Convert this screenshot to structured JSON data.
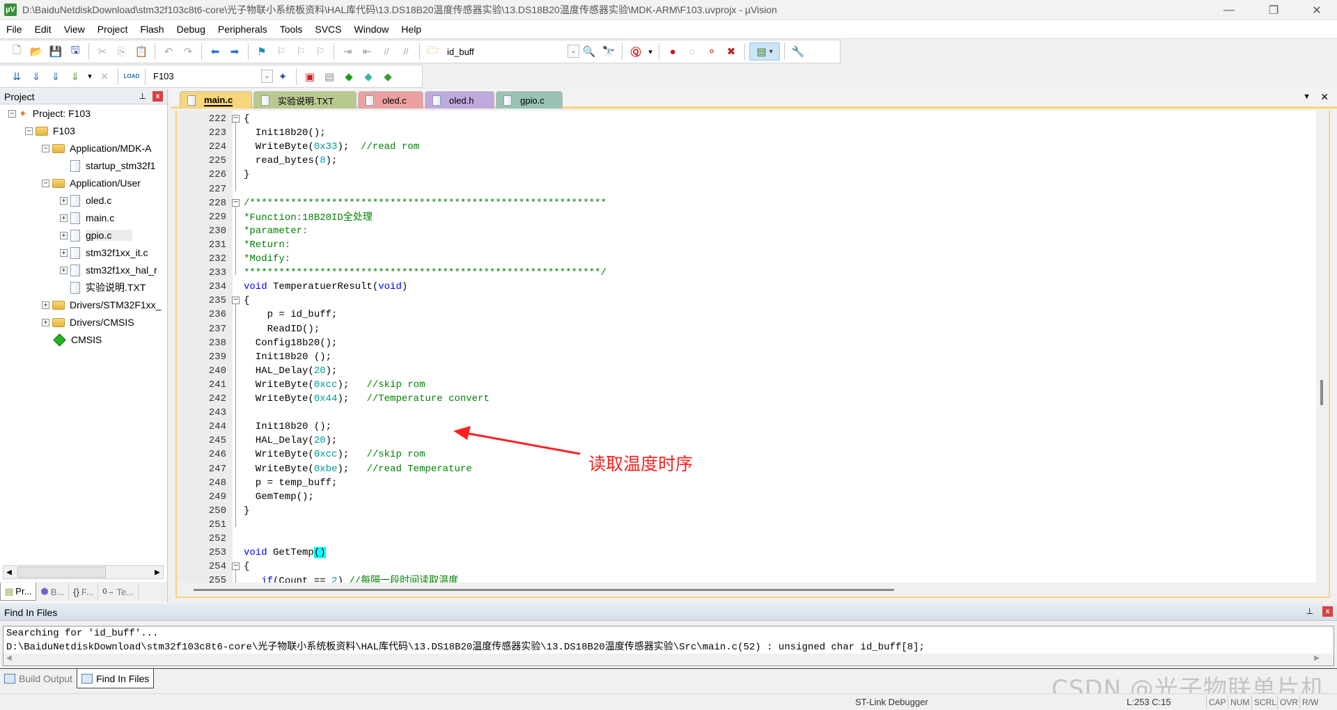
{
  "window": {
    "title": "D:\\BaiduNetdiskDownload\\stm32f103c8t6-core\\光子物联小系统板资料\\HAL库代码\\13.DS18B20温度传感器实验\\13.DS18B20温度传感器实验\\MDK-ARM\\F103.uvprojx - µVision",
    "app_icon": "µV",
    "minimize": "—",
    "maximize": "❐",
    "close": "✕"
  },
  "menu": [
    "File",
    "Edit",
    "View",
    "Project",
    "Flash",
    "Debug",
    "Peripherals",
    "Tools",
    "SVCS",
    "Window",
    "Help"
  ],
  "toolbar1": {
    "icons": {
      "new": "🗋",
      "open": "📂",
      "save": "💾",
      "save_all": "🖫",
      "cut": "✂",
      "copy": "⎘",
      "paste": "📋",
      "undo": "↶",
      "redo": "↷",
      "nav_back": "⬅",
      "nav_forward": "➡",
      "bookmark": "⚑",
      "prev_bookmark": "⚐",
      "next_bookmark": "⚐",
      "clear_bookmarks": "⚐",
      "indent": "⇥",
      "unindent": "⇤",
      "comment": "//",
      "uncomment": "//",
      "find_in_files": "🗁",
      "find": "🔍",
      "incremental_find": "🔭",
      "debug": "Ⓠ",
      "dropdown": "▾",
      "breakpoint": "●",
      "disable_breakpoint": "○",
      "disable_all_bp": "⚬",
      "kill_all_bp": "✖",
      "window_layout": "▤",
      "configure": "🔧"
    },
    "search_value": "id_buff"
  },
  "toolbar2": {
    "icons": {
      "translate": "⇊",
      "build": "⇓",
      "rebuild": "⇓",
      "batch_build": "⇓",
      "stop_build": "✕",
      "download": "LOAD",
      "options": "✦",
      "manage_components": "▣",
      "file_extensions": "▤",
      "run_time_env": "◆",
      "select_packs": "◆",
      "pack_installer": "◆"
    },
    "target_value": "F103"
  },
  "project_panel": {
    "title": "Project",
    "pin": "⊥",
    "close": "x",
    "tree": [
      {
        "label": "Project: F103",
        "level": 0,
        "expander": "−",
        "icon": "project"
      },
      {
        "label": "F103",
        "level": 1,
        "expander": "−",
        "icon": "target"
      },
      {
        "label": "Application/MDK-A",
        "level": 2,
        "expander": "−",
        "icon": "folder"
      },
      {
        "label": "startup_stm32f1",
        "level": 3,
        "expander": "",
        "icon": "file"
      },
      {
        "label": "Application/User",
        "level": 2,
        "expander": "−",
        "icon": "folder"
      },
      {
        "label": "oled.c",
        "level": 3,
        "expander": "+",
        "icon": "file"
      },
      {
        "label": "main.c",
        "level": 3,
        "expander": "+",
        "icon": "file"
      },
      {
        "label": "gpio.c",
        "level": 3,
        "expander": "+",
        "icon": "file",
        "selected": true
      },
      {
        "label": "stm32f1xx_it.c",
        "level": 3,
        "expander": "+",
        "icon": "file"
      },
      {
        "label": "stm32f1xx_hal_r",
        "level": 3,
        "expander": "+",
        "icon": "file"
      },
      {
        "label": "实验说明.TXT",
        "level": 3,
        "expander": "",
        "icon": "file"
      },
      {
        "label": "Drivers/STM32F1xx_",
        "level": 2,
        "expander": "+",
        "icon": "folder"
      },
      {
        "label": "Drivers/CMSIS",
        "level": 2,
        "expander": "+",
        "icon": "folder"
      },
      {
        "label": "CMSIS",
        "level": 2,
        "expander": "",
        "icon": "diamond"
      }
    ],
    "scroll_left": "◀",
    "scroll_right": "▶",
    "tabs": [
      {
        "label": "Pr...",
        "icon": "▤",
        "active": true
      },
      {
        "label": "B...",
        "icon": "⬢",
        "active": false
      },
      {
        "label": "F...",
        "icon": "{}",
        "active": false
      },
      {
        "label": "Te...",
        "icon": "0→",
        "active": false
      }
    ]
  },
  "editor": {
    "tabs": [
      {
        "label": "main.c",
        "color": "#f8d67c",
        "active": true
      },
      {
        "label": "实验说明.TXT",
        "color": "#b7c98f",
        "active": false
      },
      {
        "label": "oled.c",
        "color": "#eba1a1",
        "active": false
      },
      {
        "label": "oled.h",
        "color": "#c0a9dc",
        "active": false
      },
      {
        "label": "gpio.c",
        "color": "#98c2b4",
        "active": false
      }
    ],
    "tab_menu": "▼",
    "tab_close": "✕",
    "lines": [
      {
        "n": "222",
        "fold": "−",
        "tokens": [
          [
            "p",
            "{"
          ]
        ]
      },
      {
        "n": "223",
        "tokens": [
          [
            "p",
            "  Init18b20();"
          ]
        ]
      },
      {
        "n": "224",
        "tokens": [
          [
            "p",
            "  WriteByte("
          ],
          [
            "num",
            "0x33"
          ],
          [
            "p",
            ");  "
          ],
          [
            "cm",
            "//read rom"
          ]
        ]
      },
      {
        "n": "225",
        "tokens": [
          [
            "p",
            "  read_bytes("
          ],
          [
            "num",
            "8"
          ],
          [
            "p",
            ");"
          ]
        ]
      },
      {
        "n": "226",
        "tokens": [
          [
            "p",
            "}"
          ]
        ]
      },
      {
        "n": "227",
        "tokens": []
      },
      {
        "n": "228",
        "fold": "−",
        "tokens": [
          [
            "cm",
            "/*************************************************************"
          ]
        ]
      },
      {
        "n": "229",
        "tokens": [
          [
            "cm",
            "*Function:18B20ID"
          ],
          [
            "cmcjk",
            "全处理"
          ]
        ]
      },
      {
        "n": "230",
        "tokens": [
          [
            "cm",
            "*parameter:"
          ]
        ]
      },
      {
        "n": "231",
        "tokens": [
          [
            "cm",
            "*Return:"
          ]
        ]
      },
      {
        "n": "232",
        "tokens": [
          [
            "cm",
            "*Modify:"
          ]
        ]
      },
      {
        "n": "233",
        "tokens": [
          [
            "cm",
            "*************************************************************/"
          ]
        ]
      },
      {
        "n": "234",
        "tokens": [
          [
            "kw",
            "void"
          ],
          [
            "p",
            " TemperatuerResult("
          ],
          [
            "kw",
            "void"
          ],
          [
            "p",
            ")"
          ]
        ]
      },
      {
        "n": "235",
        "fold": "−",
        "tokens": [
          [
            "p",
            "{"
          ]
        ]
      },
      {
        "n": "236",
        "tokens": [
          [
            "p",
            "    p = id_buff;"
          ]
        ]
      },
      {
        "n": "237",
        "tokens": [
          [
            "p",
            "    ReadID();"
          ]
        ]
      },
      {
        "n": "238",
        "tokens": [
          [
            "p",
            "  Config18b20();"
          ]
        ]
      },
      {
        "n": "239",
        "tokens": [
          [
            "p",
            "  Init18b20 ();"
          ]
        ]
      },
      {
        "n": "240",
        "tokens": [
          [
            "p",
            "  HAL_Delay("
          ],
          [
            "num",
            "20"
          ],
          [
            "p",
            ");"
          ]
        ]
      },
      {
        "n": "241",
        "tokens": [
          [
            "p",
            "  WriteByte("
          ],
          [
            "num",
            "0xcc"
          ],
          [
            "p",
            ");   "
          ],
          [
            "cm",
            "//skip rom"
          ]
        ]
      },
      {
        "n": "242",
        "tokens": [
          [
            "p",
            "  WriteByte("
          ],
          [
            "num",
            "0x44"
          ],
          [
            "p",
            ");   "
          ],
          [
            "cm",
            "//Temperature convert"
          ]
        ]
      },
      {
        "n": "243",
        "tokens": []
      },
      {
        "n": "244",
        "tokens": [
          [
            "p",
            "  Init18b20 ();"
          ]
        ]
      },
      {
        "n": "245",
        "tokens": [
          [
            "p",
            "  HAL_Delay("
          ],
          [
            "num",
            "20"
          ],
          [
            "p",
            ");"
          ]
        ]
      },
      {
        "n": "246",
        "tokens": [
          [
            "p",
            "  WriteByte("
          ],
          [
            "num",
            "0xcc"
          ],
          [
            "p",
            ");   "
          ],
          [
            "cm",
            "//skip rom"
          ]
        ]
      },
      {
        "n": "247",
        "tokens": [
          [
            "p",
            "  WriteByte("
          ],
          [
            "num",
            "0xbe"
          ],
          [
            "p",
            ");   "
          ],
          [
            "cm",
            "//read Temperature"
          ]
        ]
      },
      {
        "n": "248",
        "tokens": [
          [
            "p",
            "  p = temp_buff;"
          ]
        ]
      },
      {
        "n": "249",
        "tokens": [
          [
            "p",
            "  GemTemp();"
          ]
        ]
      },
      {
        "n": "250",
        "tokens": [
          [
            "p",
            "}"
          ]
        ]
      },
      {
        "n": "251",
        "tokens": []
      },
      {
        "n": "252",
        "tokens": []
      },
      {
        "n": "253",
        "tokens": [
          [
            "kw",
            "void"
          ],
          [
            "p",
            " GetTemp"
          ],
          [
            "hl",
            "()"
          ]
        ]
      },
      {
        "n": "254",
        "fold": "−",
        "tokens": [
          [
            "p",
            "{"
          ]
        ]
      },
      {
        "n": "255",
        "tokens": [
          [
            "p",
            "   "
          ],
          [
            "kw",
            "if"
          ],
          [
            "p",
            "(Count == "
          ],
          [
            "num",
            "2"
          ],
          [
            "p",
            ") "
          ],
          [
            "cm",
            "//"
          ],
          [
            "cmcjk",
            "每隔一段时间读取温度"
          ]
        ]
      }
    ]
  },
  "annotation": {
    "text": "读取温度时序",
    "color": "#ff2020"
  },
  "find_panel": {
    "title": "Find In Files",
    "pin": "⊥",
    "close": "x",
    "output": [
      "Searching for 'id_buff'...",
      "D:\\BaiduNetdiskDownload\\stm32f103c8t6-core\\光子物联小系统板资料\\HAL库代码\\13.DS18B20温度传感器实验\\13.DS18B20温度传感器实验\\Src\\main.c(52) : unsigned char  id_buff[8];"
    ],
    "scroll_left": "◀",
    "scroll_right": "▶",
    "tabs": [
      {
        "label": "Build Output",
        "active": false
      },
      {
        "label": "Find In Files",
        "active": true
      }
    ]
  },
  "status_bar": {
    "debugger": "ST-Link Debugger",
    "position": "L:253 C:15",
    "flags": [
      "CAP",
      "NUM",
      "SCRL",
      "OVR",
      "R/W"
    ]
  },
  "watermark": "CSDN @光子物联单片机"
}
